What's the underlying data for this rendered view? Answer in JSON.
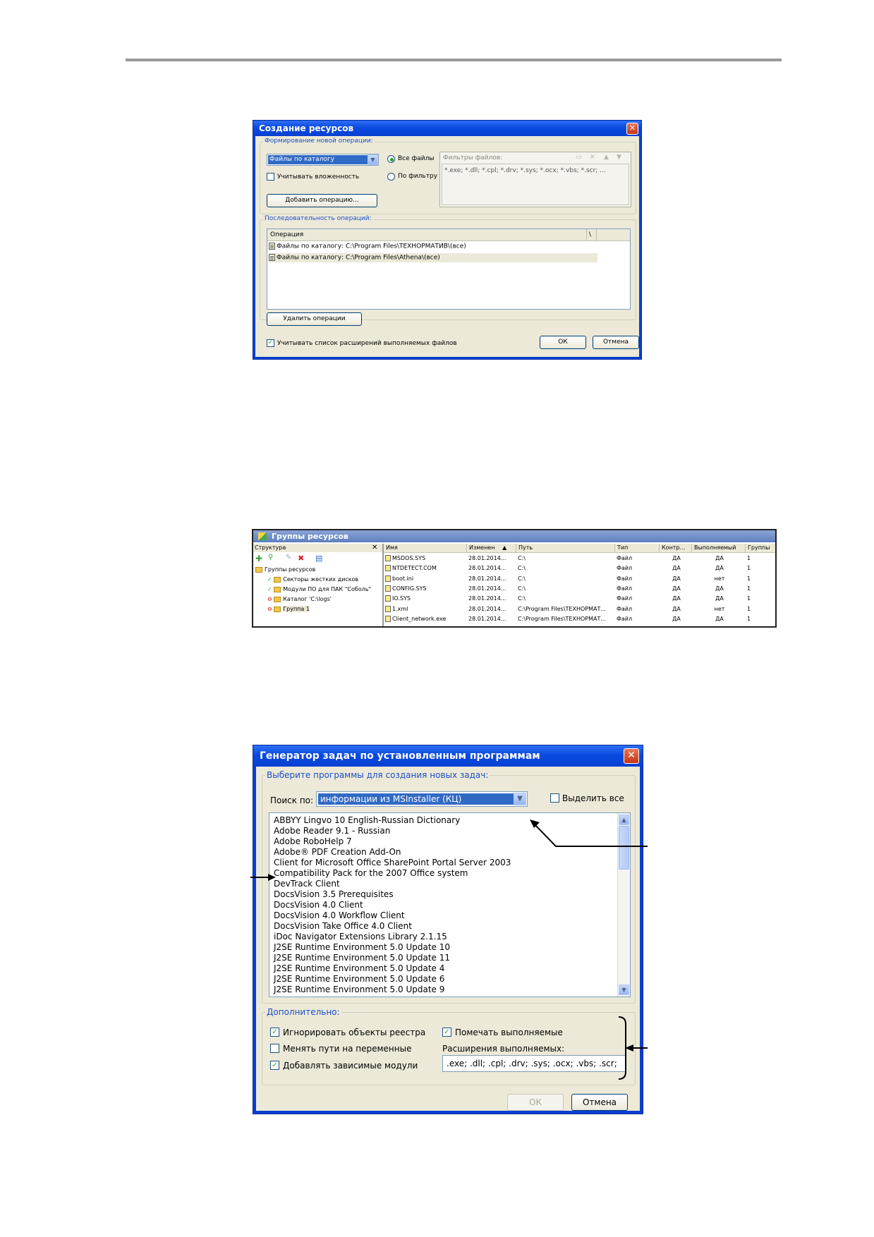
{
  "dialog1": {
    "title": "Создание ресурсов",
    "group_new_operation": "Формирование новой операции:",
    "combo_value": "Файлы по каталогу",
    "radio_all_files": "Все файлы",
    "radio_by_filter": "По фильтру",
    "checkbox_nesting": "Учитывать вложенность",
    "add_operation_button": "Добавить операцию...",
    "filters_label": "Фильтры файлов:",
    "filters_text": "*.exe; *.dll; *.cpl; *.drv; *.sys; *.ocx; *.vbs; *.scr; ...",
    "group_sequence": "Последовательность операций:",
    "column_operation": "Операция",
    "column_extra": "\\",
    "operations": [
      "Файлы по каталогу: C:\\Program Files\\ТЕХНОРМАТИВ\\(все)",
      "Файлы по каталогу: C:\\Program Files\\Athena\\(все)"
    ],
    "delete_operations_button": "Удалить операции",
    "checkbox_extensions": "Учитывать список расширений выполняемых файлов",
    "ok_button": "ОК",
    "cancel_button": "Отмена"
  },
  "panel2": {
    "title": "Группы ресурсов",
    "structure_label": "Структура",
    "close_glyph": "✕",
    "tree": [
      {
        "label": "Группы ресурсов",
        "state": "root"
      },
      {
        "label": "Секторы жестких дисков",
        "state": "check"
      },
      {
        "label": "Модули ПО для ПАК \"Соболь\"",
        "state": "check"
      },
      {
        "label": "Каталог 'C:\\logs'",
        "state": "stop"
      },
      {
        "label": "Группа 1",
        "state": "stop"
      }
    ],
    "columns": [
      "Имя",
      "Изменен",
      "Путь",
      "Тип",
      "Контр...",
      "Выполняемый",
      "Группы"
    ],
    "sort_glyph": "▲",
    "rows": [
      [
        "MSDOS.SYS",
        "28.01.2014...",
        "C:\\",
        "Файл",
        "ДА",
        "ДА",
        "1"
      ],
      [
        "NTDETECT.COM",
        "28.01.2014...",
        "C:\\",
        "Файл",
        "ДА",
        "ДА",
        "1"
      ],
      [
        "boot.ini",
        "28.01.2014...",
        "C:\\",
        "Файл",
        "ДА",
        "нет",
        "1"
      ],
      [
        "CONFIG.SYS",
        "28.01.2014...",
        "C:\\",
        "Файл",
        "ДА",
        "ДА",
        "1"
      ],
      [
        "IO.SYS",
        "28.01.2014...",
        "C:\\",
        "Файл",
        "ДА",
        "ДА",
        "1"
      ],
      [
        "1.xml",
        "28.01.2014...",
        "C:\\Program Files\\ТЕХНОРМАТ...",
        "Файл",
        "ДА",
        "нет",
        "1"
      ],
      [
        "Client_network.exe",
        "28.01.2014...",
        "C:\\Program Files\\ТЕХНОРМАТ...",
        "Файл",
        "ДА",
        "ДА",
        "1"
      ]
    ]
  },
  "dialog3": {
    "title": "Генератор задач по установленным программам",
    "group_select": "Выберите программы для создания новых задач:",
    "search_label": "Поиск по:",
    "search_value": "информации из MSInstaller (КЦ)",
    "select_all": "Выделить все",
    "programs": [
      "ABBYY Lingvo 10 English-Russian Dictionary",
      "Adobe Reader 9.1 - Russian",
      "Adobe RoboHelp 7",
      "Adobe® PDF Creation Add-On",
      "Client for Microsoft Office SharePoint Portal Server 2003",
      "Compatibility Pack for the 2007 Office system",
      "DevTrack Client",
      "DocsVision 3.5 Prerequisites",
      "DocsVision 4.0 Client",
      "DocsVision 4.0 Workflow Client",
      "DocsVision Take Office 4.0 Client",
      "iDoc Navigator Extensions Library 2.1.15",
      "J2SE Runtime Environment 5.0 Update 10",
      "J2SE Runtime Environment 5.0 Update 11",
      "J2SE Runtime Environment 5.0 Update 4",
      "J2SE Runtime Environment 5.0 Update 6",
      "J2SE Runtime Environment 5.0 Update 9"
    ],
    "group_additional": "Дополнительно:",
    "ignore_registry": "Игнорировать объекты реестра",
    "change_paths": "Менять пути на переменные",
    "add_dependent": "Добавлять зависимые модули",
    "mark_executable": "Помечать выполняемые",
    "extensions_label": "Расширения выполняемых:",
    "extensions_value": ".exe; .dll; .cpl; .drv; .sys; .ocx; .vbs; .scr;",
    "ok_button": "ОК",
    "cancel_button": "Отмена",
    "check_glyph": "✓"
  }
}
